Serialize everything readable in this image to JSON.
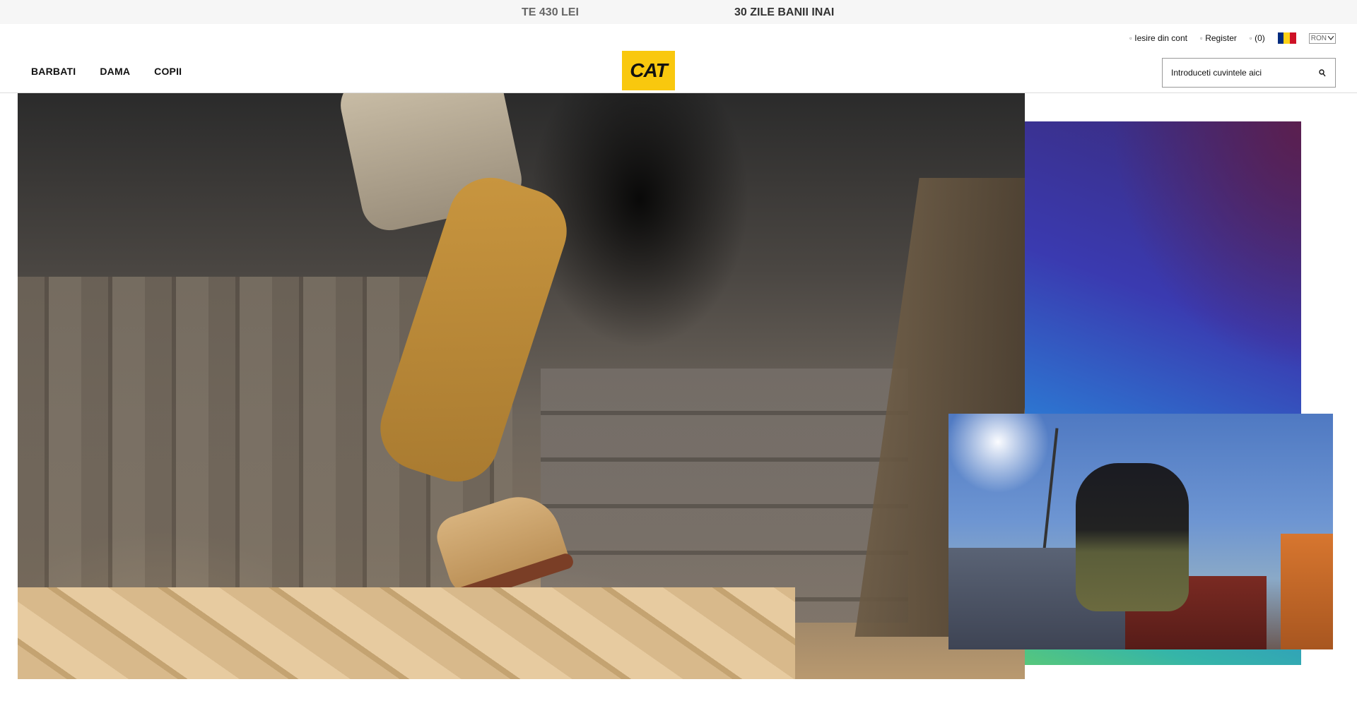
{
  "promo": {
    "item1": "TE 430 LEI",
    "item2": "30 ZILE BANII INAI"
  },
  "utility": {
    "logout": "Iesire din cont",
    "register": "Register",
    "cart": "(0)",
    "currency": "RON",
    "flag_colors": [
      "#002B7F",
      "#FCD116",
      "#CE1126"
    ]
  },
  "nav": {
    "items": [
      {
        "label": "BARBATI"
      },
      {
        "label": "DAMA"
      },
      {
        "label": "COPII"
      }
    ]
  },
  "logo": {
    "text": "CAT",
    "color": "#f9c80e"
  },
  "search": {
    "placeholder": "Introduceti cuvintele aici"
  }
}
